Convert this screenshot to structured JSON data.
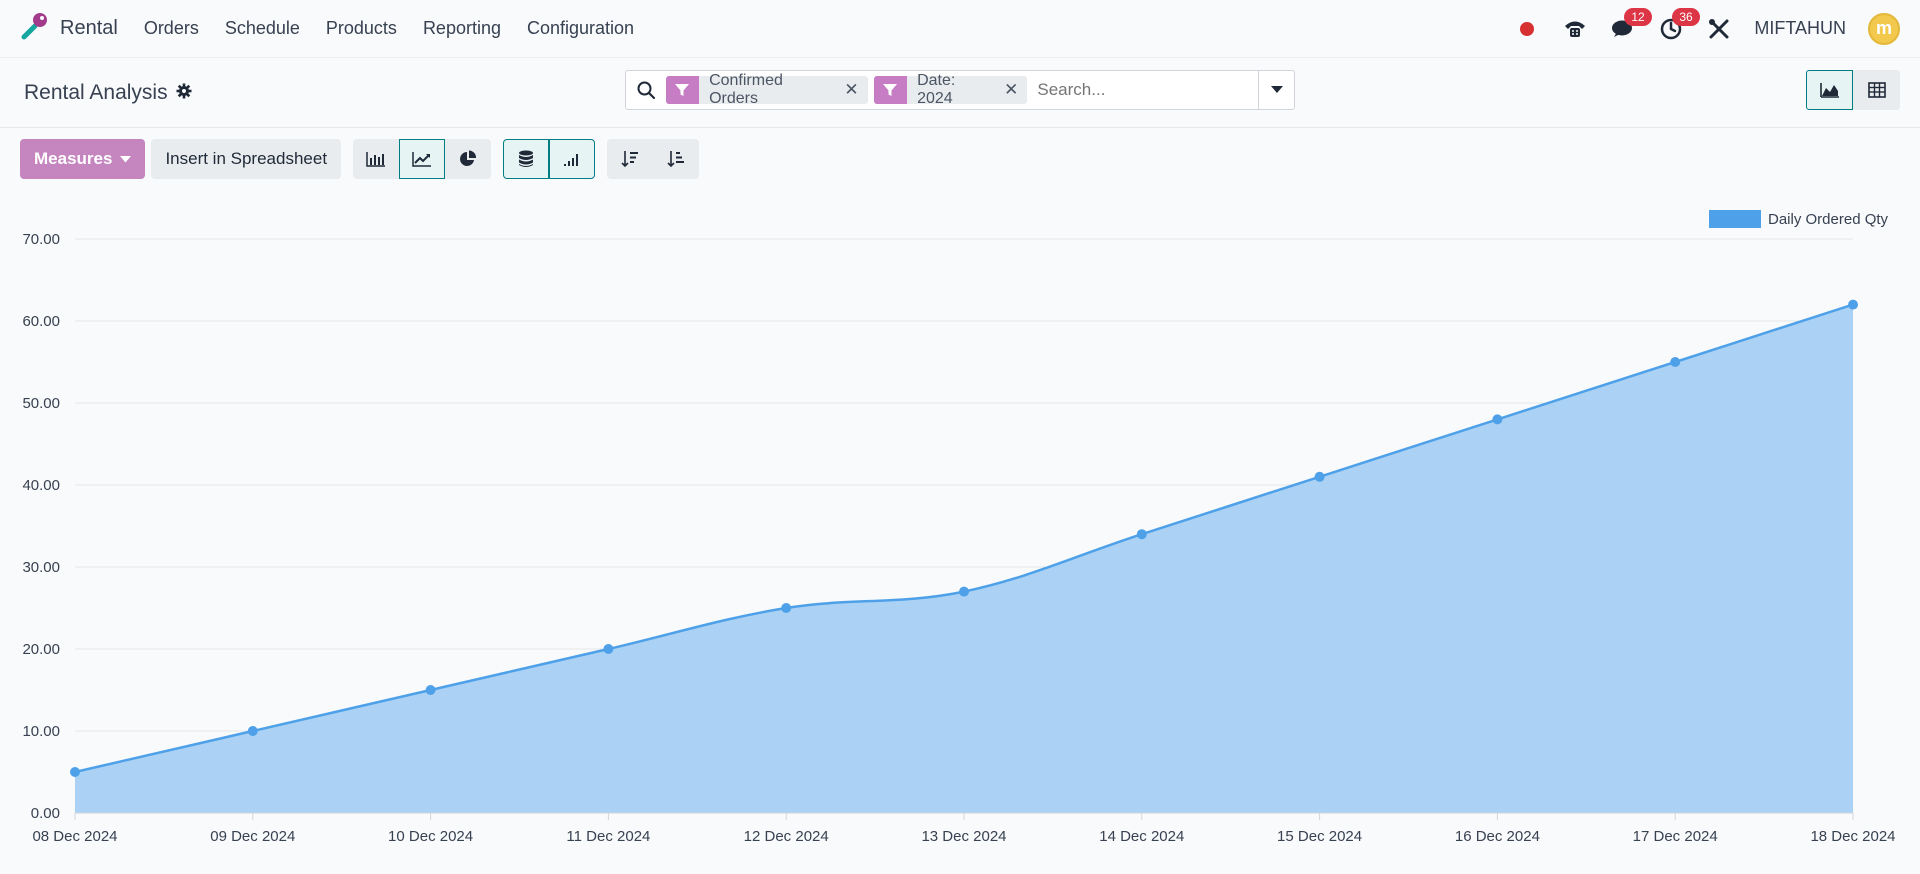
{
  "app": {
    "name": "Rental"
  },
  "menu": [
    {
      "label": "Orders"
    },
    {
      "label": "Schedule"
    },
    {
      "label": "Products"
    },
    {
      "label": "Reporting"
    },
    {
      "label": "Configuration"
    }
  ],
  "systray": {
    "messages_count": "12",
    "activities_count": "36",
    "user_name": "MIFTAHUN",
    "avatar_letter": "m"
  },
  "control": {
    "page_title": "Rental Analysis",
    "facets": [
      {
        "label": "Confirmed Orders"
      },
      {
        "label": "Date: 2024"
      }
    ],
    "search_placeholder": "Search..."
  },
  "toolbar": {
    "measures_label": "Measures",
    "spreadsheet_label": "Insert in Spreadsheet"
  },
  "colors": {
    "accent": "#c586c0",
    "teal": "#017e84",
    "series_line": "#4ea1e8",
    "series_fill": "#a6d0f4",
    "record_dot": "#d63031"
  },
  "chart_data": {
    "type": "area",
    "categories": [
      "08 Dec 2024",
      "09 Dec 2024",
      "10 Dec 2024",
      "11 Dec 2024",
      "12 Dec 2024",
      "13 Dec 2024",
      "14 Dec 2024",
      "15 Dec 2024",
      "16 Dec 2024",
      "17 Dec 2024",
      "18 Dec 2024"
    ],
    "series": [
      {
        "name": "Daily Ordered Qty",
        "values": [
          5,
          10,
          15,
          20,
          25,
          27,
          34,
          41,
          48,
          55,
          62
        ]
      }
    ],
    "yticks": [
      "0.00",
      "10.00",
      "20.00",
      "30.00",
      "40.00",
      "50.00",
      "60.00",
      "70.00"
    ],
    "ylim": [
      0,
      70
    ],
    "grid": true,
    "legend": "top-right"
  }
}
